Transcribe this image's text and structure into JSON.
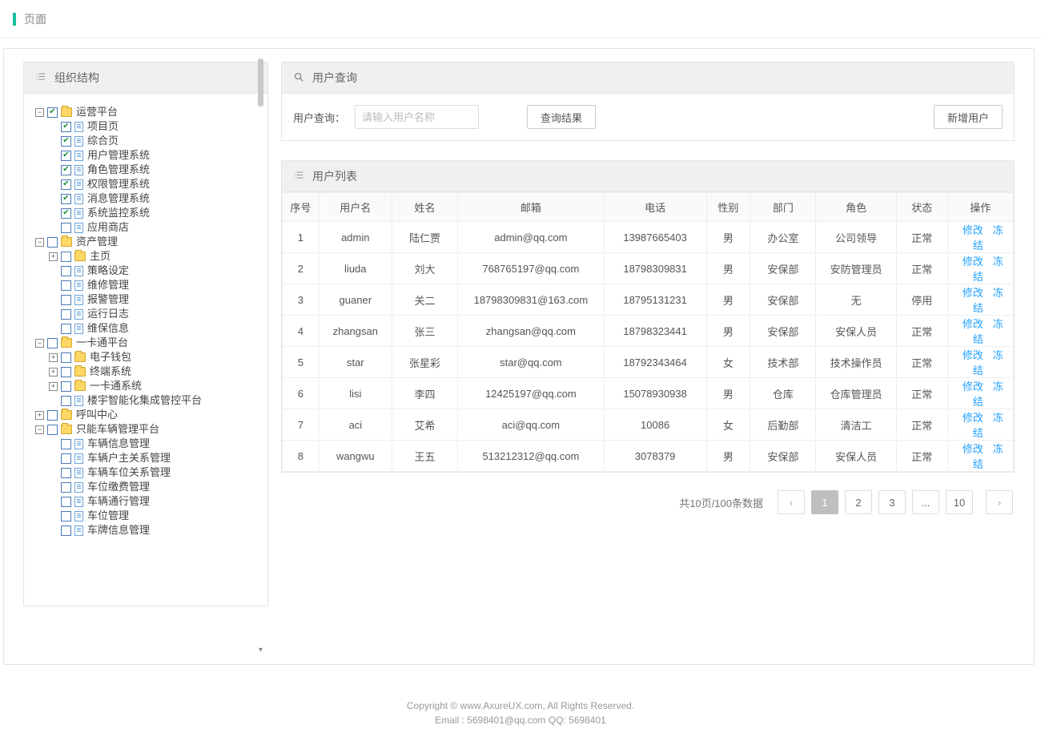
{
  "header": {
    "title": "页面"
  },
  "sidebar": {
    "title": "组织结构",
    "tree": [
      {
        "indent": 0,
        "toggle": "-",
        "checked": true,
        "icon": "folder",
        "label": "运营平台"
      },
      {
        "indent": 1,
        "toggle": "",
        "checked": true,
        "icon": "file",
        "label": "项目页"
      },
      {
        "indent": 1,
        "toggle": "",
        "checked": true,
        "icon": "file",
        "label": "综合页"
      },
      {
        "indent": 1,
        "toggle": "",
        "checked": true,
        "icon": "file",
        "label": "用户管理系统"
      },
      {
        "indent": 1,
        "toggle": "",
        "checked": true,
        "icon": "file",
        "label": "角色管理系统"
      },
      {
        "indent": 1,
        "toggle": "",
        "checked": true,
        "icon": "file",
        "label": "权限管理系统"
      },
      {
        "indent": 1,
        "toggle": "",
        "checked": true,
        "icon": "file",
        "label": "消息管理系统"
      },
      {
        "indent": 1,
        "toggle": "",
        "checked": true,
        "icon": "file",
        "label": "系统监控系统"
      },
      {
        "indent": 1,
        "toggle": "",
        "checked": false,
        "icon": "file",
        "label": "应用商店"
      },
      {
        "indent": 0,
        "toggle": "-",
        "checked": false,
        "icon": "folder",
        "label": "资产管理"
      },
      {
        "indent": 1,
        "toggle": "+",
        "checked": false,
        "icon": "folder",
        "label": "主页"
      },
      {
        "indent": 1,
        "toggle": "",
        "checked": false,
        "icon": "file",
        "label": "策略设定"
      },
      {
        "indent": 1,
        "toggle": "",
        "checked": false,
        "icon": "file",
        "label": "维修管理"
      },
      {
        "indent": 1,
        "toggle": "",
        "checked": false,
        "icon": "file",
        "label": "报警管理"
      },
      {
        "indent": 1,
        "toggle": "",
        "checked": false,
        "icon": "file",
        "label": "运行日志"
      },
      {
        "indent": 1,
        "toggle": "",
        "checked": false,
        "icon": "file",
        "label": "维保信息"
      },
      {
        "indent": 0,
        "toggle": "-",
        "checked": false,
        "icon": "folder",
        "label": "一卡通平台"
      },
      {
        "indent": 1,
        "toggle": "+",
        "checked": false,
        "icon": "folder",
        "label": "电子钱包"
      },
      {
        "indent": 1,
        "toggle": "+",
        "checked": false,
        "icon": "folder",
        "label": "终端系统"
      },
      {
        "indent": 1,
        "toggle": "+",
        "checked": false,
        "icon": "folder",
        "label": "一卡通系统"
      },
      {
        "indent": 1,
        "toggle": "",
        "checked": false,
        "icon": "file",
        "label": "楼宇智能化集成管控平台"
      },
      {
        "indent": 0,
        "toggle": "+",
        "checked": false,
        "icon": "folder",
        "label": "呼叫中心"
      },
      {
        "indent": 0,
        "toggle": "-",
        "checked": false,
        "icon": "folder",
        "label": "只能车辆管理平台"
      },
      {
        "indent": 1,
        "toggle": "",
        "checked": false,
        "icon": "file",
        "label": "车辆信息管理"
      },
      {
        "indent": 1,
        "toggle": "",
        "checked": false,
        "icon": "file",
        "label": "车辆户主关系管理"
      },
      {
        "indent": 1,
        "toggle": "",
        "checked": false,
        "icon": "file",
        "label": "车辆车位关系管理"
      },
      {
        "indent": 1,
        "toggle": "",
        "checked": false,
        "icon": "file",
        "label": "车位缴费管理"
      },
      {
        "indent": 1,
        "toggle": "",
        "checked": false,
        "icon": "file",
        "label": "车辆通行管理"
      },
      {
        "indent": 1,
        "toggle": "",
        "checked": false,
        "icon": "file",
        "label": "车位管理"
      },
      {
        "indent": 1,
        "toggle": "",
        "checked": false,
        "icon": "file",
        "label": "车牌信息管理"
      }
    ]
  },
  "search": {
    "panel_title": "用户查询",
    "label": "用户查询：",
    "placeholder": "请输入用户名称",
    "query_btn": "查询结果",
    "add_btn": "新增用户"
  },
  "list": {
    "panel_title": "用户列表",
    "columns": [
      "序号",
      "用户名",
      "姓名",
      "邮箱",
      "电话",
      "性别",
      "部门",
      "角色",
      "状态",
      "操作"
    ],
    "op_edit": "修改",
    "op_freeze": "冻结",
    "rows": [
      {
        "idx": "1",
        "user": "admin",
        "name": "陆仁贾",
        "email": "admin@qq.com",
        "phone": "13987665403",
        "sex": "男",
        "dept": "办公室",
        "role": "公司领导",
        "status": "正常"
      },
      {
        "idx": "2",
        "user": "liuda",
        "name": "刘大",
        "email": "768765197@qq.com",
        "phone": "18798309831",
        "sex": "男",
        "dept": "安保部",
        "role": "安防管理员",
        "status": "正常"
      },
      {
        "idx": "3",
        "user": "guaner",
        "name": "关二",
        "email": "18798309831@163.com",
        "phone": "18795131231",
        "sex": "男",
        "dept": "安保部",
        "role": "无",
        "status": "停用"
      },
      {
        "idx": "4",
        "user": "zhangsan",
        "name": "张三",
        "email": "zhangsan@qq.com",
        "phone": "18798323441",
        "sex": "男",
        "dept": "安保部",
        "role": "安保人员",
        "status": "正常"
      },
      {
        "idx": "5",
        "user": "star",
        "name": "张星彩",
        "email": "star@qq.com",
        "phone": "18792343464",
        "sex": "女",
        "dept": "技术部",
        "role": "技术操作员",
        "status": "正常"
      },
      {
        "idx": "6",
        "user": "lisi",
        "name": "李四",
        "email": "12425197@qq.com",
        "phone": "15078930938",
        "sex": "男",
        "dept": "仓库",
        "role": "仓库管理员",
        "status": "正常"
      },
      {
        "idx": "7",
        "user": "aci",
        "name": "艾希",
        "email": "aci@qq.com",
        "phone": "10086",
        "sex": "女",
        "dept": "后勤部",
        "role": "清洁工",
        "status": "正常"
      },
      {
        "idx": "8",
        "user": "wangwu",
        "name": "王五",
        "email": "513212312@qq.com",
        "phone": "3078379",
        "sex": "男",
        "dept": "安保部",
        "role": "安保人员",
        "status": "正常"
      }
    ]
  },
  "pager": {
    "info": "共10页/100条数据",
    "pages": [
      "1",
      "2",
      "3",
      "...",
      "10"
    ],
    "active": "1"
  },
  "footer": {
    "line1": "Copyright © www.AxureUX.com, All Rights Reserved.",
    "line2": "Email : 5698401@qq.com  QQ: 5698401"
  }
}
